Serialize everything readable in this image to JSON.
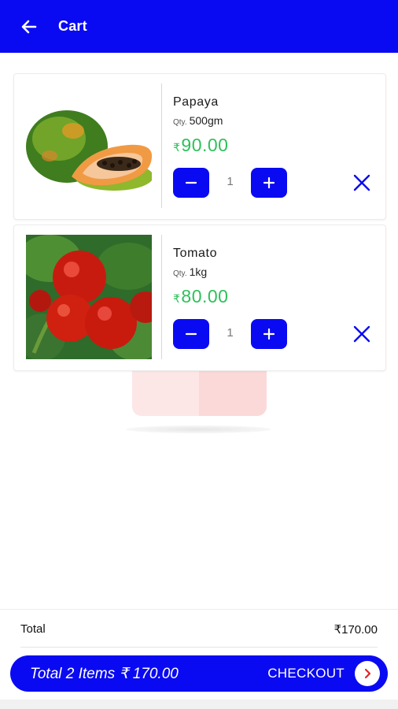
{
  "appbar": {
    "title": "Cart",
    "back_icon": "arrow-left-icon",
    "color": "#0a0af2"
  },
  "cart": {
    "items": [
      {
        "name": "Papaya",
        "qty_label": "Qty.",
        "qty_value": "500gm",
        "currency": "₹",
        "price": "90.00",
        "count": "1",
        "image": "papaya-image"
      },
      {
        "name": "Tomato",
        "qty_label": "Qty.",
        "qty_value": "1kg",
        "currency": "₹",
        "price": "80.00",
        "count": "1",
        "image": "tomato-image"
      }
    ],
    "icons": {
      "minus": "minus-icon",
      "plus": "plus-icon",
      "remove": "close-icon"
    },
    "price_color": "#2ec05a"
  },
  "footer": {
    "total_label": "Total",
    "total_value": "₹170.00",
    "checkout_summary": "Total 2 Items ₹ 170.00",
    "checkout_label": "CHECKOUT",
    "checkout_icon": "chevron-right-icon"
  }
}
